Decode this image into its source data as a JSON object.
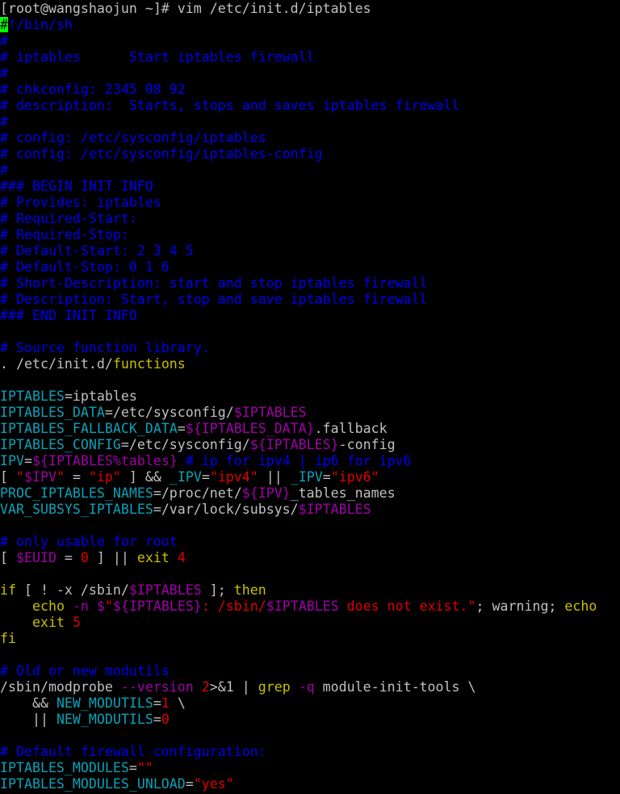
{
  "colors": {
    "default": "#c0c0c0",
    "comment": "#0000ee",
    "variable": "#0aa2b8",
    "keyword": "#c8c000",
    "string": "#e00000",
    "special": "#a000a8",
    "cursor": "#00ff00"
  },
  "lines": [
    [
      [
        "d",
        "[root@wangshaojun ~]# vim /etc/init.d/iptables"
      ]
    ],
    [
      [
        "cursor",
        "#"
      ],
      [
        "comment",
        "!/bin/sh"
      ]
    ],
    [
      [
        "comment",
        "#"
      ]
    ],
    [
      [
        "comment",
        "# iptables      Start iptables firewall"
      ]
    ],
    [
      [
        "comment",
        "#"
      ]
    ],
    [
      [
        "comment",
        "# chkconfig: 2345 08 92"
      ]
    ],
    [
      [
        "comment",
        "# description:  Starts, stops and saves iptables firewall"
      ]
    ],
    [
      [
        "comment",
        "#"
      ]
    ],
    [
      [
        "comment",
        "# config: /etc/sysconfig/iptables"
      ]
    ],
    [
      [
        "comment",
        "# config: /etc/sysconfig/iptables-config"
      ]
    ],
    [
      [
        "comment",
        "#"
      ]
    ],
    [
      [
        "comment",
        "### BEGIN INIT INFO"
      ]
    ],
    [
      [
        "comment",
        "# Provides: iptables"
      ]
    ],
    [
      [
        "comment",
        "# Required-Start:"
      ]
    ],
    [
      [
        "comment",
        "# Required-Stop:"
      ]
    ],
    [
      [
        "comment",
        "# Default-Start: 2 3 4 5"
      ]
    ],
    [
      [
        "comment",
        "# Default-Stop: 0 1 6"
      ]
    ],
    [
      [
        "comment",
        "# Short-Description: start and stop iptables firewall"
      ]
    ],
    [
      [
        "comment",
        "# Description: Start, stop and save iptables firewall"
      ]
    ],
    [
      [
        "comment",
        "### END INIT INFO"
      ]
    ],
    [
      [
        "d",
        ""
      ]
    ],
    [
      [
        "comment",
        "# Source function library."
      ]
    ],
    [
      [
        "d",
        ". /etc/init.d/"
      ],
      [
        "keyword",
        "functions"
      ]
    ],
    [
      [
        "d",
        ""
      ]
    ],
    [
      [
        "variable",
        "IPTABLES"
      ],
      [
        "d",
        "=iptables"
      ]
    ],
    [
      [
        "variable",
        "IPTABLES_DATA"
      ],
      [
        "d",
        "=/etc/sysconfig/"
      ],
      [
        "special",
        "$IPTABLES"
      ]
    ],
    [
      [
        "variable",
        "IPTABLES_FALLBACK_DATA"
      ],
      [
        "d",
        "="
      ],
      [
        "special",
        "${IPTABLES_DATA}"
      ],
      [
        "d",
        ".fallback"
      ]
    ],
    [
      [
        "variable",
        "IPTABLES_CONFIG"
      ],
      [
        "d",
        "=/etc/sysconfig/"
      ],
      [
        "special",
        "${IPTABLES}"
      ],
      [
        "d",
        "-config"
      ]
    ],
    [
      [
        "variable",
        "IPV"
      ],
      [
        "d",
        "="
      ],
      [
        "special",
        "${IPTABLES%tables}"
      ],
      [
        "d",
        " "
      ],
      [
        "comment",
        "# ip for ipv4 | ip6 for ipv6"
      ]
    ],
    [
      [
        "d",
        "[ "
      ],
      [
        "string",
        "\""
      ],
      [
        "special",
        "$IPV"
      ],
      [
        "string",
        "\""
      ],
      [
        "d",
        " = "
      ],
      [
        "string",
        "\"ip\""
      ],
      [
        "d",
        " ] && "
      ],
      [
        "variable",
        "_IPV"
      ],
      [
        "d",
        "="
      ],
      [
        "string",
        "\"ipv4\""
      ],
      [
        "d",
        " || "
      ],
      [
        "variable",
        "_IPV"
      ],
      [
        "d",
        "="
      ],
      [
        "string",
        "\"ipv6\""
      ]
    ],
    [
      [
        "variable",
        "PROC_IPTABLES_NAMES"
      ],
      [
        "d",
        "=/proc/net/"
      ],
      [
        "special",
        "${IPV}"
      ],
      [
        "d",
        "_tables_names"
      ]
    ],
    [
      [
        "variable",
        "VAR_SUBSYS_IPTABLES"
      ],
      [
        "d",
        "=/var/lock/subsys/"
      ],
      [
        "special",
        "$IPTABLES"
      ]
    ],
    [
      [
        "d",
        ""
      ]
    ],
    [
      [
        "comment",
        "# only usable for root"
      ]
    ],
    [
      [
        "d",
        "[ "
      ],
      [
        "special",
        "$EUID"
      ],
      [
        "d",
        " = "
      ],
      [
        "string",
        "0"
      ],
      [
        "d",
        " ] || "
      ],
      [
        "keyword",
        "exit"
      ],
      [
        "d",
        " "
      ],
      [
        "string",
        "4"
      ]
    ],
    [
      [
        "d",
        ""
      ]
    ],
    [
      [
        "keyword",
        "if"
      ],
      [
        "d",
        " [ ! -x /sbin/"
      ],
      [
        "special",
        "$IPTABLES"
      ],
      [
        "d",
        " ]; "
      ],
      [
        "keyword",
        "then"
      ]
    ],
    [
      [
        "d",
        "    "
      ],
      [
        "keyword",
        "echo"
      ],
      [
        "d",
        " "
      ],
      [
        "special",
        "-n $"
      ],
      [
        "string",
        "\""
      ],
      [
        "special",
        "${IPTABLES}"
      ],
      [
        "string",
        ": /sbin/"
      ],
      [
        "special",
        "$IPTABLES"
      ],
      [
        "string",
        " does not exist.\""
      ],
      [
        "d",
        "; warning; "
      ],
      [
        "keyword",
        "echo"
      ]
    ],
    [
      [
        "d",
        "    "
      ],
      [
        "keyword",
        "exit"
      ],
      [
        "d",
        " "
      ],
      [
        "string",
        "5"
      ]
    ],
    [
      [
        "keyword",
        "fi"
      ]
    ],
    [
      [
        "d",
        ""
      ]
    ],
    [
      [
        "comment",
        "# Old or new modutils"
      ]
    ],
    [
      [
        "d",
        "/sbin/modprobe "
      ],
      [
        "special",
        "--version"
      ],
      [
        "d",
        " "
      ],
      [
        "string",
        "2"
      ],
      [
        "d",
        ">&1 | "
      ],
      [
        "keyword",
        "grep"
      ],
      [
        "d",
        " "
      ],
      [
        "special",
        "-q"
      ],
      [
        "d",
        " module-init-tools \\"
      ]
    ],
    [
      [
        "d",
        "    && "
      ],
      [
        "variable",
        "NEW_MODUTILS"
      ],
      [
        "d",
        "="
      ],
      [
        "string",
        "1"
      ],
      [
        "d",
        " \\"
      ]
    ],
    [
      [
        "d",
        "    || "
      ],
      [
        "variable",
        "NEW_MODUTILS"
      ],
      [
        "d",
        "="
      ],
      [
        "string",
        "0"
      ]
    ],
    [
      [
        "d",
        ""
      ]
    ],
    [
      [
        "comment",
        "# Default firewall configuration:"
      ]
    ],
    [
      [
        "variable",
        "IPTABLES_MODULES"
      ],
      [
        "d",
        "="
      ],
      [
        "string",
        "\"\""
      ]
    ],
    [
      [
        "variable",
        "IPTABLES_MODULES_UNLOAD"
      ],
      [
        "d",
        "="
      ],
      [
        "string",
        "\"yes\""
      ]
    ]
  ]
}
